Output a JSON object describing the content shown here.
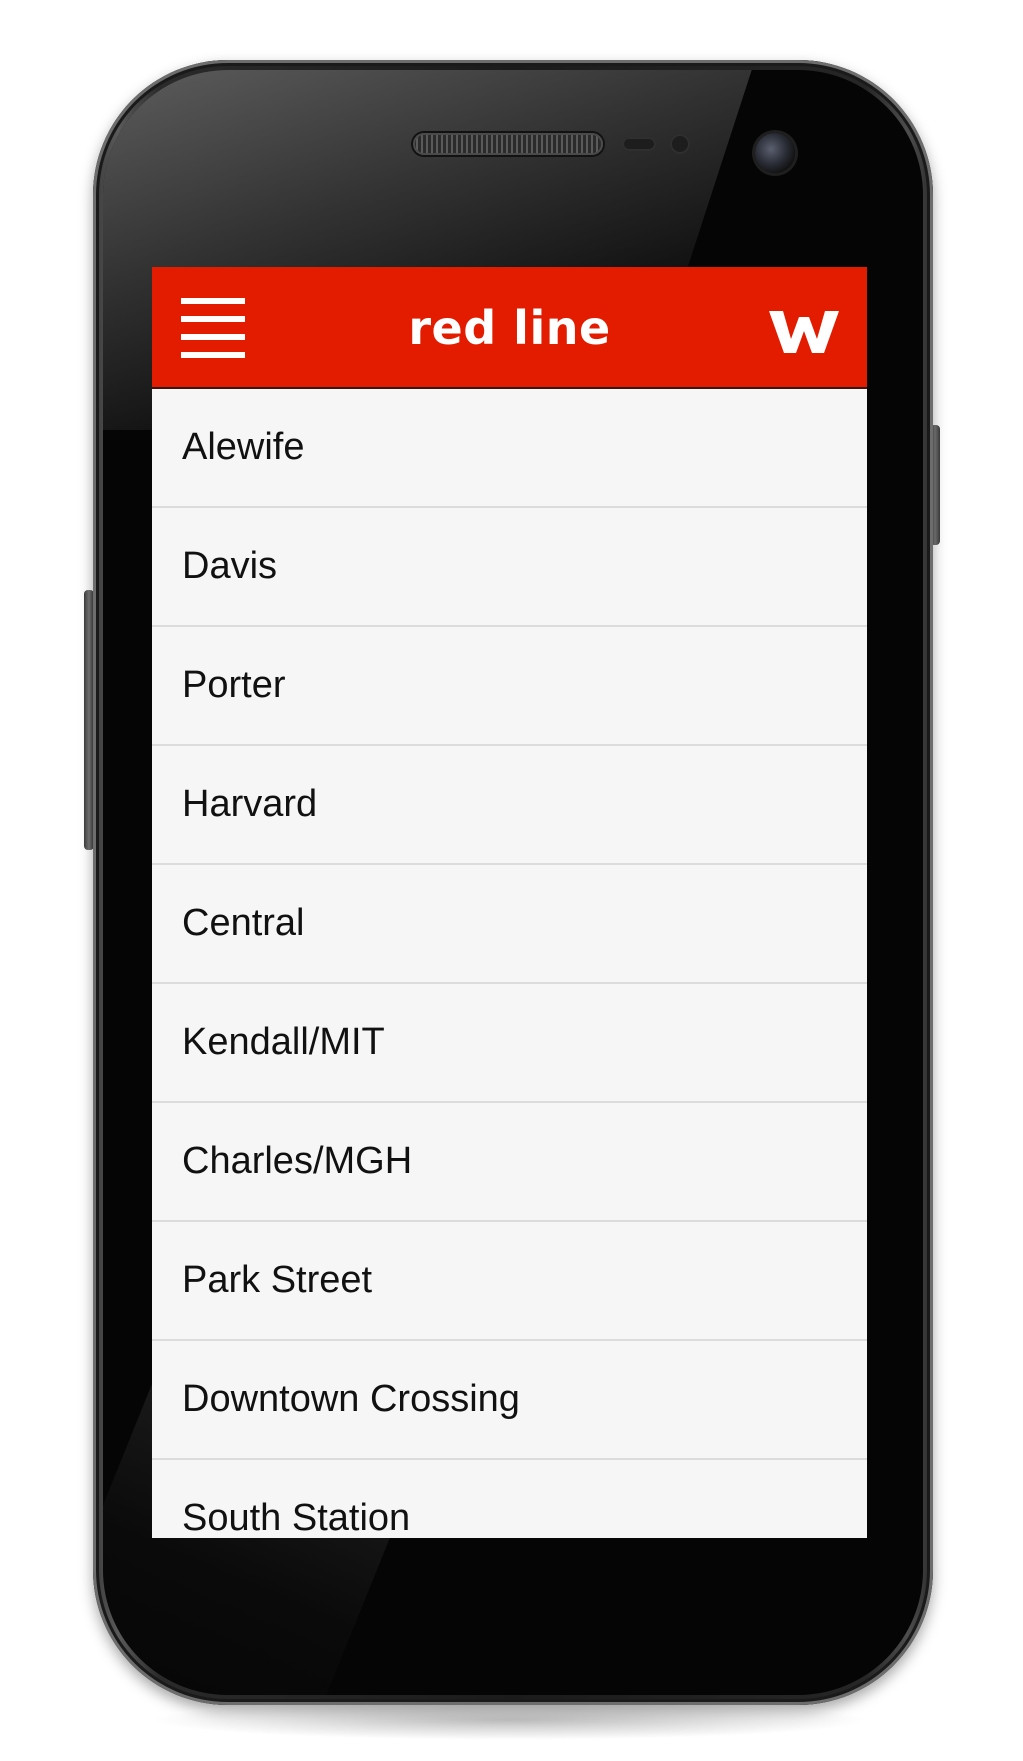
{
  "app_bar": {
    "title": "red line",
    "menu_icon": "hamburger-menu-icon",
    "logo_icon": "w-logo-icon",
    "background_color": "#e31c00",
    "text_color": "#ffffff"
  },
  "stations": [
    {
      "label": "Alewife"
    },
    {
      "label": "Davis"
    },
    {
      "label": "Porter"
    },
    {
      "label": "Harvard"
    },
    {
      "label": "Central"
    },
    {
      "label": "Kendall/MIT"
    },
    {
      "label": "Charles/MGH"
    },
    {
      "label": "Park Street"
    },
    {
      "label": "Downtown Crossing"
    },
    {
      "label": "South Station"
    }
  ],
  "list_colors": {
    "background": "#f6f6f6",
    "divider": "#dcdcdc",
    "text": "#111111"
  }
}
